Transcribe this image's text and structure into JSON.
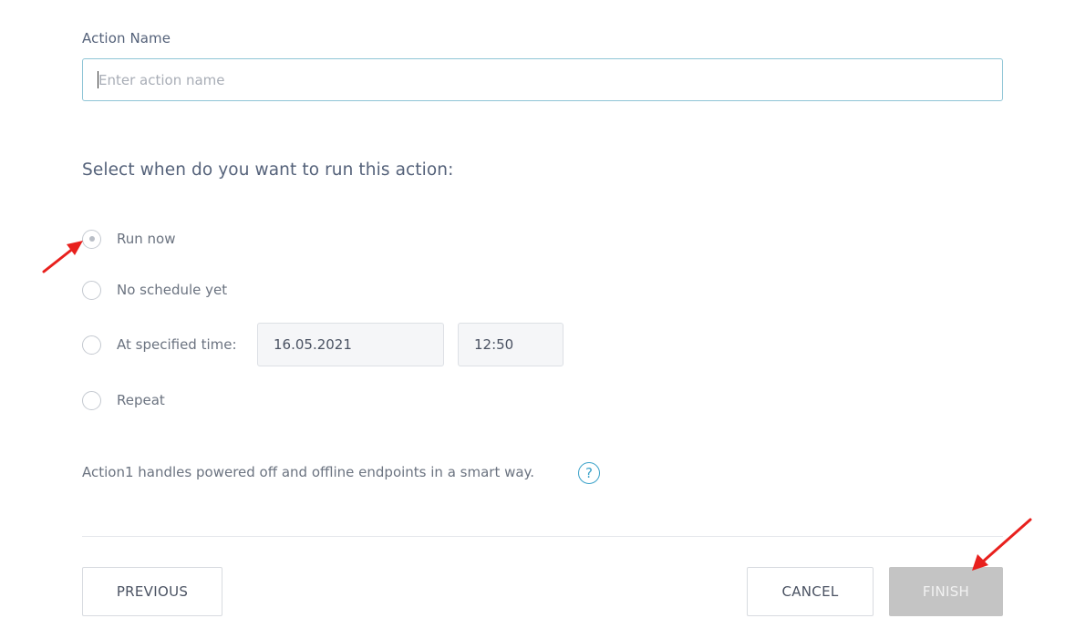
{
  "action_name": {
    "label": "Action Name",
    "placeholder": "Enter action name",
    "value": ""
  },
  "schedule": {
    "title": "Select when do you want to run this action:",
    "options": [
      {
        "label": "Run now",
        "selected": true
      },
      {
        "label": "No schedule yet",
        "selected": false
      },
      {
        "label": "At specified time:",
        "selected": false
      },
      {
        "label": "Repeat",
        "selected": false
      }
    ],
    "date": "16.05.2021",
    "time": "12:50"
  },
  "info": {
    "text": "Action1 handles powered off and offline endpoints in a smart way.",
    "help_symbol": "?"
  },
  "buttons": {
    "previous": "PREVIOUS",
    "cancel": "CANCEL",
    "finish": "FINISH"
  },
  "colors": {
    "annotation_arrow": "#e8201d",
    "input_border": "#8fc5d6",
    "help_icon": "#3ba2c9",
    "finish_disabled_bg": "#c4c4c4"
  },
  "icons": {
    "help": "question-circle-icon",
    "annotation": "red-arrow-icon"
  }
}
